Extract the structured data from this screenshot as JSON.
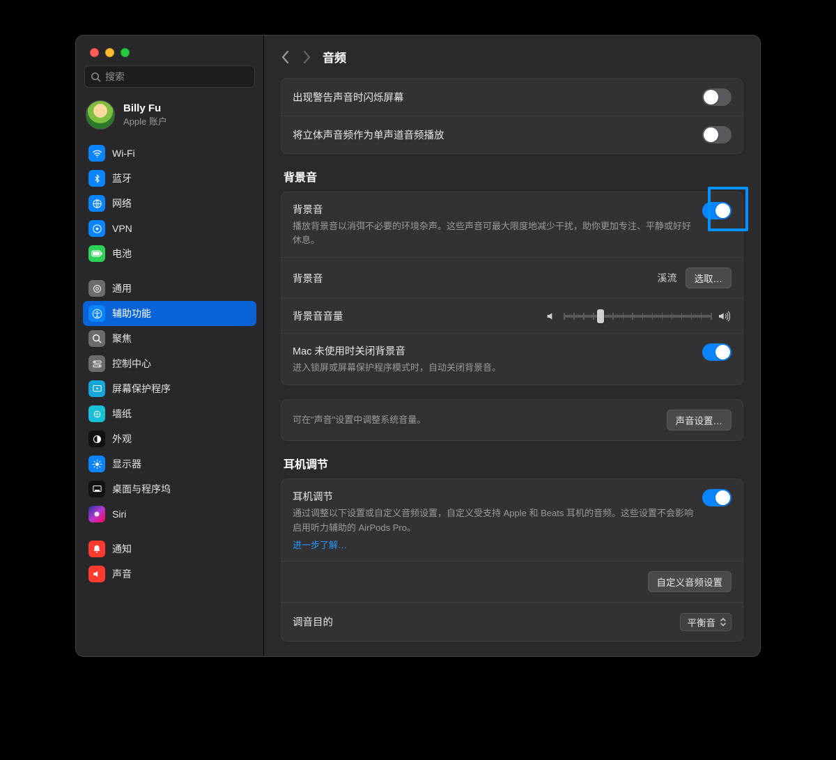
{
  "sidebar": {
    "search_placeholder": "搜索",
    "account": {
      "name": "Billy Fu",
      "sub": "Apple 账户"
    },
    "items": [
      {
        "label": "Wi-Fi"
      },
      {
        "label": "蓝牙"
      },
      {
        "label": "网络"
      },
      {
        "label": "VPN"
      },
      {
        "label": "电池"
      }
    ],
    "items2": [
      {
        "label": "通用"
      },
      {
        "label": "辅助功能"
      },
      {
        "label": "聚焦"
      },
      {
        "label": "控制中心"
      },
      {
        "label": "屏幕保护程序"
      },
      {
        "label": "墙纸"
      },
      {
        "label": "外观"
      },
      {
        "label": "显示器"
      },
      {
        "label": "桌面与程序坞"
      },
      {
        "label": "Siri"
      }
    ],
    "items3": [
      {
        "label": "通知"
      },
      {
        "label": "声音"
      }
    ]
  },
  "header": {
    "title": "音频"
  },
  "rows": {
    "flash_screen": "出现警告声音时闪烁屏幕",
    "mono_audio": "将立体声音频作为单声道音频播放"
  },
  "bg": {
    "section_title": "背景音",
    "title": "背景音",
    "desc": "播放背景音以消弭不必要的环境杂声。这些声音可最大限度地减少干扰，助你更加专注、平静或好好休息。",
    "sound_label": "背景音",
    "sound_value": "溪流",
    "choose": "选取…",
    "volume_label": "背景音音量",
    "volume_percent": 25,
    "close_unused_title": "Mac 未使用时关闭背景音",
    "close_unused_desc": "进入锁屏或屏幕保护程序模式时，自动关闭背景音。",
    "system_note": "可在\"声音\"设置中调整系统音量。",
    "sound_settings_btn": "声音设置…"
  },
  "headphone": {
    "section_title": "耳机调节",
    "title": "耳机调节",
    "desc": "通过调整以下设置或自定义音频设置，自定义受支持 Apple 和 Beats 耳机的音频。这些设置不会影响启用听力辅助的 AirPods Pro。",
    "learn_more": "进一步了解…",
    "custom_btn": "自定义音频设置",
    "tune_target_label": "调音目的",
    "tune_target_value": "平衡音"
  }
}
